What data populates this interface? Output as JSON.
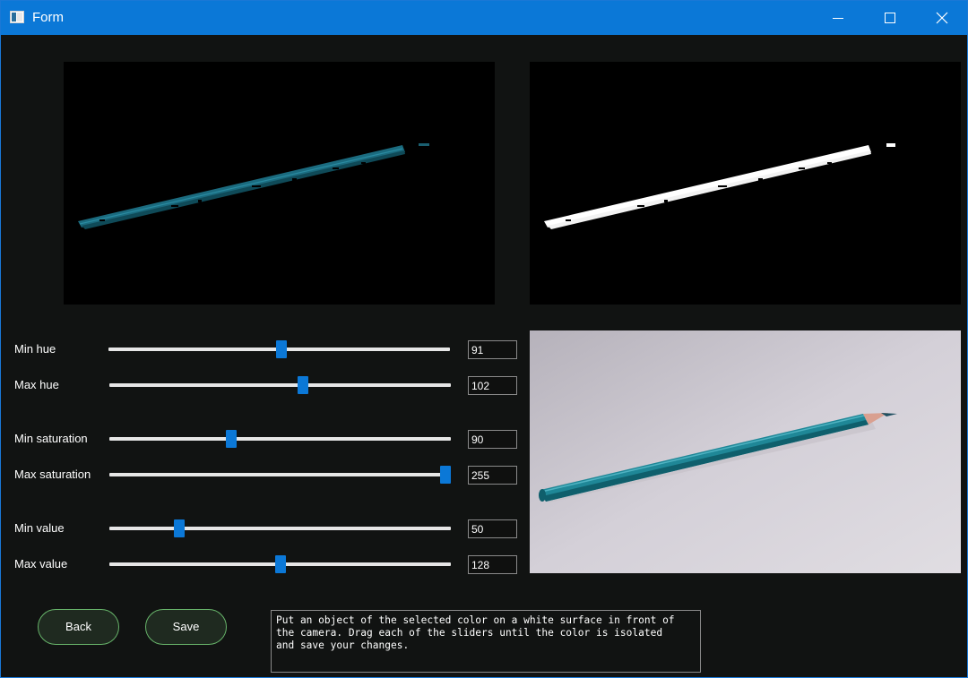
{
  "window": {
    "title": "Form",
    "accent_color": "#0b78d7"
  },
  "titlebar": {
    "icon": "window-app-icon",
    "controls": [
      "minimize-icon",
      "maximize-icon",
      "close-icon"
    ]
  },
  "preview_panels": {
    "masked_result": "masked-color-preview",
    "binary_mask": "binary-mask-preview",
    "camera_feed": "camera-feed-preview"
  },
  "sliders": [
    {
      "label": "Min hue",
      "value": "91",
      "min": 0,
      "max": 179,
      "fraction": 0.508
    },
    {
      "label": "Max hue",
      "value": "102",
      "min": 0,
      "max": 179,
      "fraction": 0.57
    },
    {
      "label": "Min saturation",
      "value": "90",
      "min": 0,
      "max": 255,
      "fraction": 0.353
    },
    {
      "label": "Max saturation",
      "value": "255",
      "min": 0,
      "max": 255,
      "fraction": 1.0
    },
    {
      "label": "Min value",
      "value": "50",
      "min": 0,
      "max": 255,
      "fraction": 0.196
    },
    {
      "label": "Max value",
      "value": "128",
      "min": 0,
      "max": 255,
      "fraction": 0.502
    }
  ],
  "buttons": {
    "back": "Back",
    "save": "Save"
  },
  "instructions": "Put an object of the selected color on a white surface in front of\nthe camera. Drag each of the sliders until the color is isolated\nand save your changes."
}
